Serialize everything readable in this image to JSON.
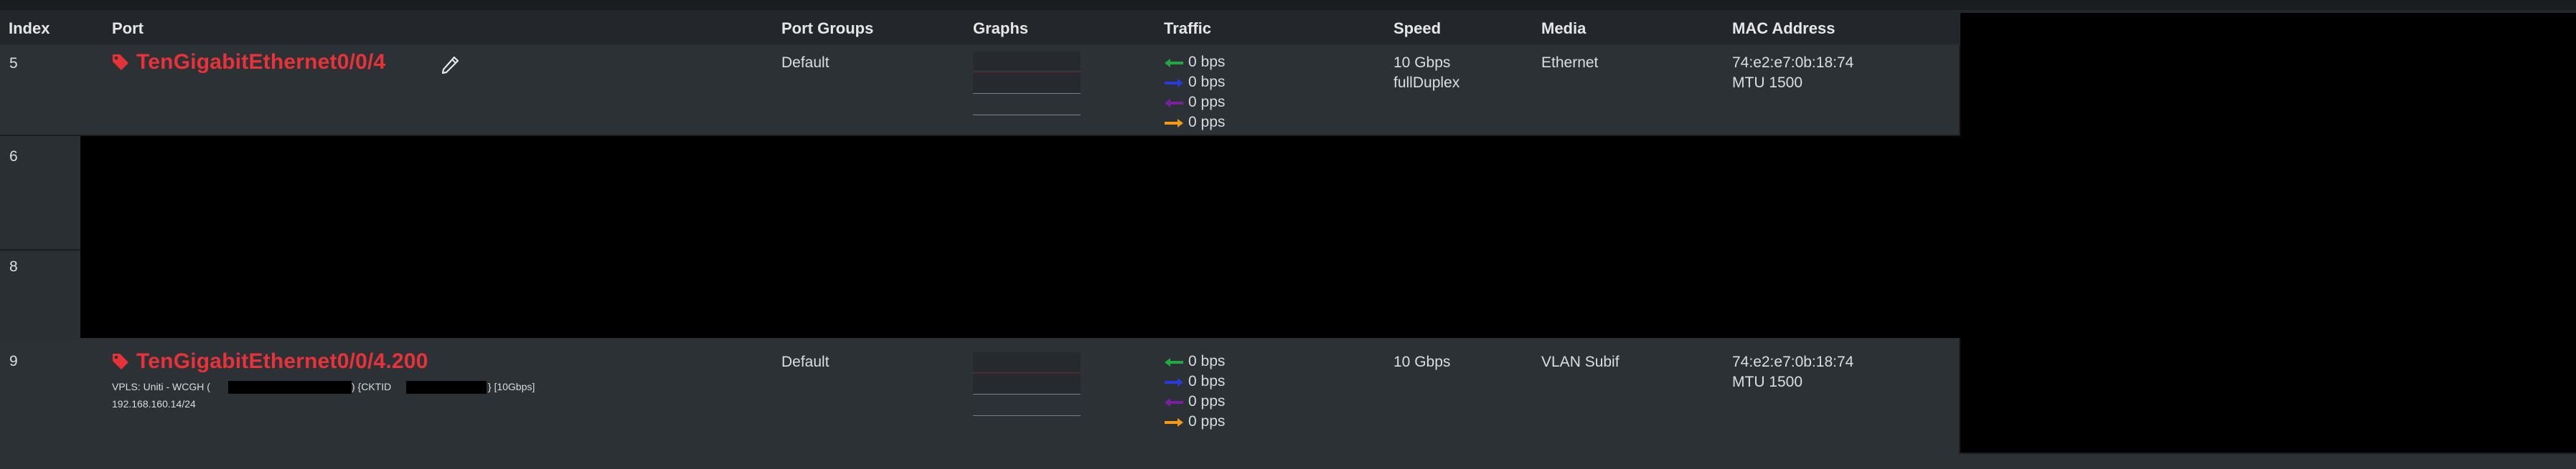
{
  "columns": {
    "index": "Index",
    "port": "Port",
    "port_groups": "Port Groups",
    "graphs": "Graphs",
    "traffic": "Traffic",
    "speed": "Speed",
    "media": "Media",
    "mac": "MAC Address"
  },
  "rows": [
    {
      "index": "5",
      "port": "TenGigabitEthernet0/0/4",
      "group": "Default",
      "traffic": [
        "0 bps",
        "0 bps",
        "0 pps",
        "0 pps"
      ],
      "speed": "10 Gbps",
      "duplex": "fullDuplex",
      "media": "Ethernet",
      "mac": "74:e2:e7:0b:18:74",
      "mtu": "MTU 1500"
    },
    {
      "index": "6"
    },
    {
      "index": "8"
    },
    {
      "index": "9",
      "port": "TenGigabitEthernet0/0/4.200",
      "description_start": "VPLS: Uniti - WCGH (",
      "description_mid": ") {CKTID",
      "description_end": "} [10Gbps]",
      "ip": "192.168.160.14/24",
      "group": "Default",
      "traffic": [
        "0 bps",
        "0 bps",
        "0 pps",
        "0 pps"
      ],
      "speed": "10 Gbps",
      "media": "VLAN Subif",
      "mac": "74:e2:e7:0b:18:74",
      "mtu": "MTU 1500"
    }
  ],
  "icons": {
    "tag": "tag-icon",
    "edit": "pencil-icon",
    "in_bps": "arrow-left-icon",
    "out_bps": "arrow-right-icon",
    "in_pps": "arrow-left-icon",
    "out_pps": "arrow-right-icon"
  },
  "colors": {
    "port_name": "#e8323a",
    "in_bps_arrow": "#22a845",
    "out_bps_arrow": "#2a3bd8",
    "in_pps_arrow": "#7a1fa0",
    "out_pps_arrow": "#f59a12"
  }
}
